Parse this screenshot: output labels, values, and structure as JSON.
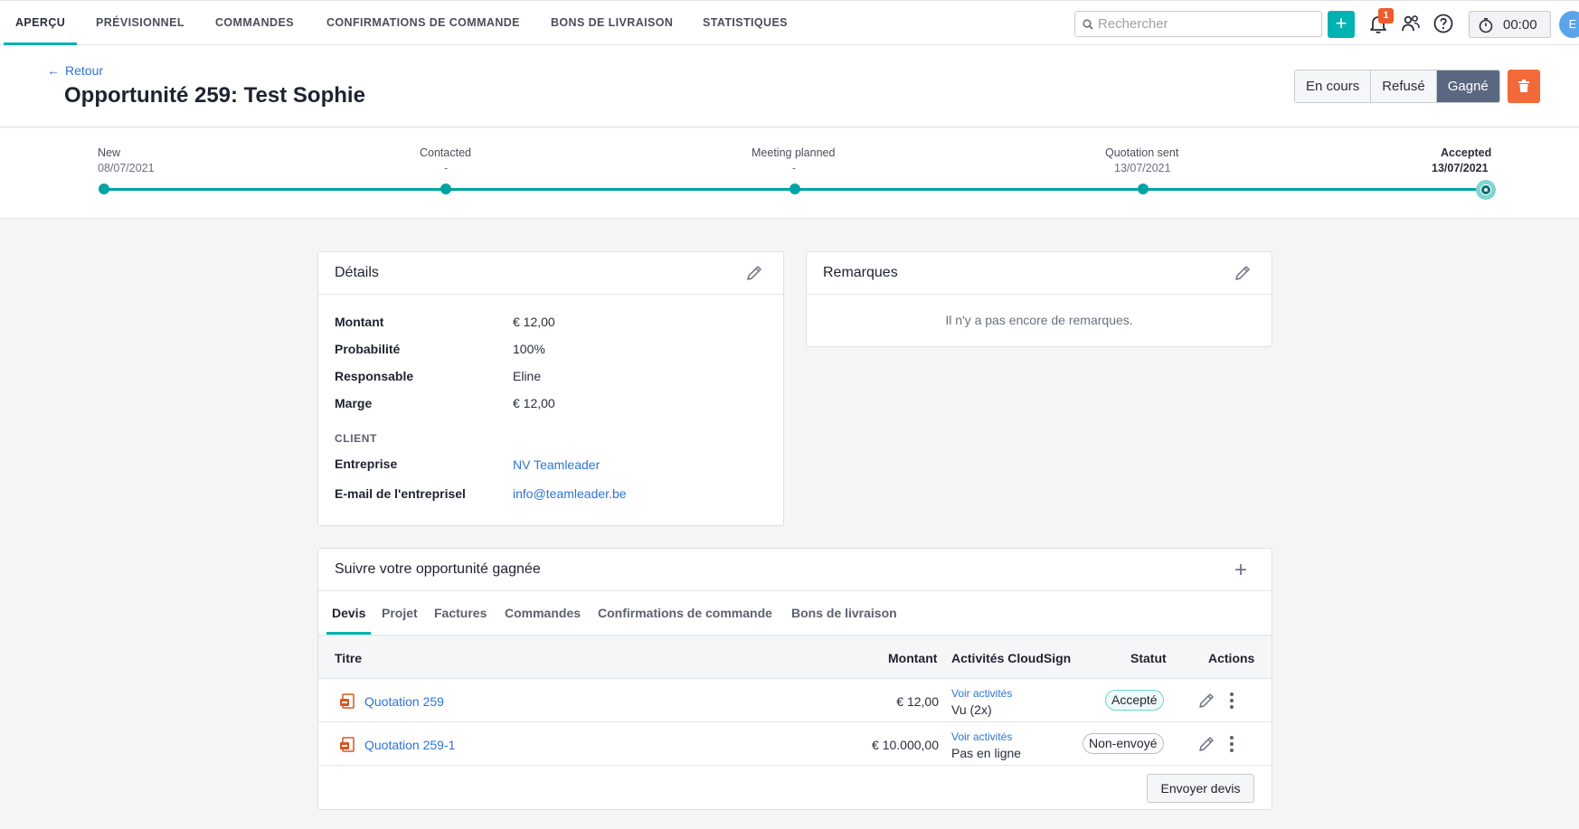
{
  "nav": {
    "tabs": [
      "APERÇU",
      "PRÉVISIONNEL",
      "COMMANDES",
      "CONFIRMATIONS DE COMMANDE",
      "BONS DE LIVRAISON",
      "STATISTIQUES"
    ],
    "search_placeholder": "Rechercher",
    "add_icon": "plus-icon",
    "notification_count": "1",
    "timer": "00:00",
    "avatar_initial": "E"
  },
  "header": {
    "back_label": "Retour",
    "title": "Opportunité 259: Test Sophie",
    "status_buttons": [
      "En cours",
      "Refusé",
      "Gagné"
    ],
    "active_status": "Gagné"
  },
  "stepper": [
    {
      "label": "New",
      "date": "08/07/2021"
    },
    {
      "label": "Contacted",
      "date": "-"
    },
    {
      "label": "Meeting planned",
      "date": "-"
    },
    {
      "label": "Quotation sent",
      "date": "13/07/2021"
    },
    {
      "label": "Accepted",
      "date": "13/07/2021"
    }
  ],
  "details": {
    "title": "Détails",
    "rows": [
      {
        "label": "Montant",
        "value": "€ 12,00"
      },
      {
        "label": "Probabilité",
        "value": "100%"
      },
      {
        "label": "Responsable",
        "value": "Eline"
      },
      {
        "label": "Marge",
        "value": "€ 12,00"
      }
    ],
    "client_section": "CLIENT",
    "client_rows": [
      {
        "label": "Entreprise",
        "value": "NV Teamleader"
      },
      {
        "label": "E-mail de l'entreprisel",
        "value": "info@teamleader.be"
      }
    ]
  },
  "remarks": {
    "title": "Remarques",
    "empty": "Il n'y a pas encore de remarques."
  },
  "follow": {
    "title": "Suivre votre opportunité gagnée",
    "tabs": [
      "Devis",
      "Projet",
      "Factures",
      "Commandes",
      "Confirmations de commande",
      "Bons de livraison"
    ],
    "columns": {
      "title": "Titre",
      "amount": "Montant",
      "activities": "Activités CloudSign",
      "status": "Statut",
      "actions": "Actions"
    },
    "rows": [
      {
        "title": "Quotation 259",
        "amount": "€ 12,00",
        "activity_link": "Voir activités",
        "activity": "Vu (2x)",
        "status": "Accepté"
      },
      {
        "title": "Quotation 259-1",
        "amount": "€ 10.000,00",
        "activity_link": "Voir activités",
        "activity": "Pas en ligne",
        "status": "Non-envoyé"
      }
    ],
    "send_button": "Envoyer devis"
  },
  "colors": {
    "accent": "#00b2b2",
    "danger": "#f26a3a",
    "link": "#2c74d6",
    "won": "#5a6781"
  }
}
